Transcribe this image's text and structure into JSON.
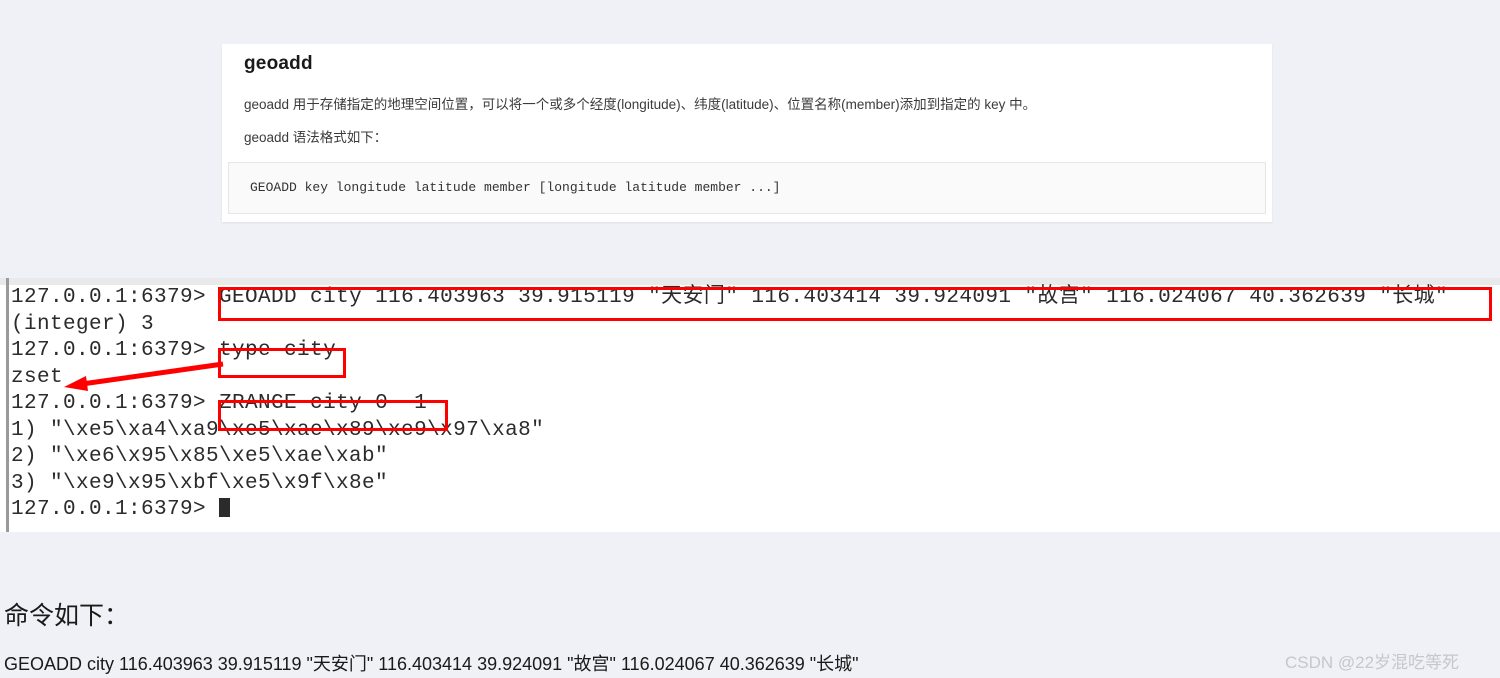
{
  "doc_panel": {
    "title": "geoadd",
    "paragraph_1": "geoadd 用于存储指定的地理空间位置，可以将一个或多个经度(longitude)、纬度(latitude)、位置名称(member)添加到指定的 key 中。",
    "paragraph_2": "geoadd 语法格式如下：",
    "code_syntax": "GEOADD key longitude latitude member [longitude latitude member ...]"
  },
  "terminal": {
    "lines": [
      {
        "prompt": "127.0.0.1:6379> ",
        "text": "GEOADD city 116.403963 39.915119 \"天安门\" 116.403414 39.924091 \"故宫\" 116.024067 40.362639 \"长城\""
      },
      {
        "prompt": "",
        "text": "(integer) 3"
      },
      {
        "prompt": "127.0.0.1:6379> ",
        "text": "type city"
      },
      {
        "prompt": "",
        "text": "zset"
      },
      {
        "prompt": "127.0.0.1:6379> ",
        "text": "ZRANGE city 0 -1"
      },
      {
        "prompt": "",
        "text": "1) \"\\xe5\\xa4\\xa9\\xe5\\xae\\x89\\xe9\\x97\\xa8\""
      },
      {
        "prompt": "",
        "text": "2) \"\\xe6\\x95\\x85\\xe5\\xae\\xab\""
      },
      {
        "prompt": "",
        "text": "3) \"\\xe9\\x95\\xbf\\xe5\\x9f\\x8e\""
      },
      {
        "prompt": "127.0.0.1:6379> ",
        "text": ""
      }
    ]
  },
  "annotations": {
    "color": "#ff0000",
    "box_geoadd_label": "GEOADD command highlight",
    "box_type_label": "type city highlight",
    "box_zrange_label": "ZRANGE command highlight",
    "arrow_label": "arrow from type city to zset"
  },
  "bottom": {
    "heading": "命令如下：",
    "command": "GEOADD city 116.403963 39.915119 \"天安门\" 116.403414 39.924091 \"故宫\" 116.024067 40.362639 \"长城\""
  },
  "watermark": {
    "text": "CSDN @22岁混吃等死"
  }
}
